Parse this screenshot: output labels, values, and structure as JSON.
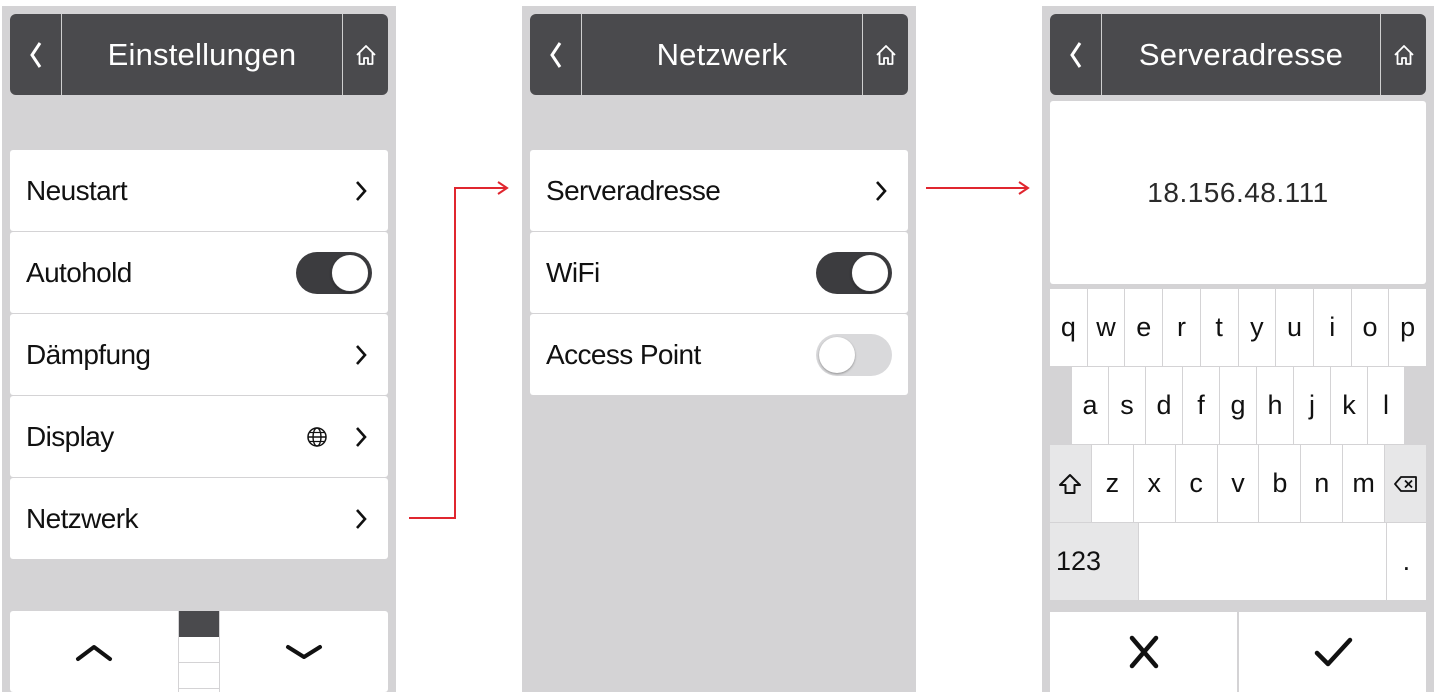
{
  "screens": [
    {
      "header": {
        "title": "Einstellungen"
      },
      "items": [
        {
          "label": "Neustart"
        },
        {
          "label": "Autohold"
        },
        {
          "label": "Dämpfung"
        },
        {
          "label": "Display"
        },
        {
          "label": "Netzwerk"
        }
      ]
    },
    {
      "header": {
        "title": "Netzwerk"
      },
      "items": [
        {
          "label": "Serveradresse"
        },
        {
          "label": "WiFi"
        },
        {
          "label": "Access Point"
        }
      ]
    },
    {
      "header": {
        "title": "Serveradresse"
      },
      "value": "18.156.48.111",
      "keyboard": {
        "row1": [
          "q",
          "w",
          "e",
          "r",
          "t",
          "y",
          "u",
          "i",
          "o",
          "p"
        ],
        "row2": [
          "a",
          "s",
          "d",
          "f",
          "g",
          "h",
          "j",
          "k",
          "l"
        ],
        "row3": [
          "z",
          "x",
          "c",
          "v",
          "b",
          "n",
          "m"
        ],
        "numbers_key": "123",
        "period_key": "."
      }
    }
  ],
  "toggles": {
    "autohold": true,
    "wifi": true,
    "access_point": false
  },
  "scroll_position": {
    "page": 1,
    "pages": 3
  },
  "icons": {
    "back": "chevron-left-icon",
    "home": "home-icon",
    "chevron": "chevron-right-icon",
    "globe": "globe-icon",
    "up": "chevron-up-icon",
    "down": "chevron-down-icon",
    "shift": "shift-icon",
    "backspace": "backspace-icon",
    "cancel": "close-icon",
    "confirm": "check-icon"
  },
  "colors": {
    "header_bg": "#4a4a4d",
    "screen_bg": "#d4d3d5",
    "connector": "#e0262f",
    "toggle_on": "#3c3c3f"
  }
}
